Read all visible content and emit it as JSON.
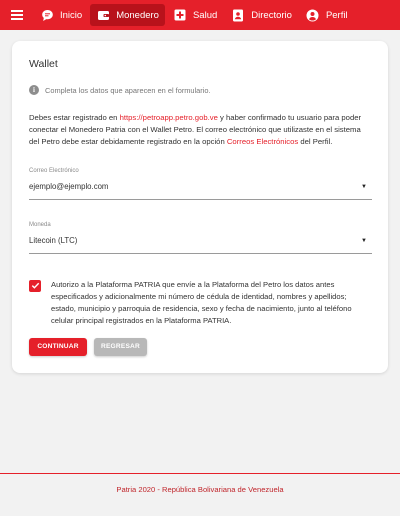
{
  "colors": {
    "brand_red": "#e5202a",
    "active_nav": "#b8121b",
    "secondary_button": "#b8b8b8"
  },
  "topbar": {
    "menu_icon": "hamburger-icon",
    "nav": [
      {
        "label": "Inicio",
        "icon": "chat-bubble-icon",
        "active": false
      },
      {
        "label": "Monedero",
        "icon": "wallet-icon",
        "active": true
      },
      {
        "label": "Salud",
        "icon": "medical-cross-icon",
        "active": false
      },
      {
        "label": "Directorio",
        "icon": "contact-card-icon",
        "active": false
      },
      {
        "label": "Perfil",
        "icon": "user-circle-icon",
        "active": false
      }
    ]
  },
  "card": {
    "title": "Wallet",
    "hint": "Completa los datos que aparecen en el formulario.",
    "intro": {
      "text1": "Debes estar registrado en ",
      "link1": "https://petroapp.petro.gob.ve",
      "text2": " y haber confirmado tu usuario para poder conectar el Monedero Patria con el Wallet Petro. El correo electrónico que utilizaste en el sistema del Petro debe estar debidamente registrado en la opción ",
      "link2": "Correos Electrónicos",
      "text3": " del Perfil."
    },
    "email_field": {
      "label": "Correo Electrónico",
      "value": "ejemplo@ejemplo.com"
    },
    "currency_field": {
      "label": "Moneda",
      "value": "Litecoin (LTC)"
    },
    "consent": {
      "checked": true,
      "text": "Autorizo a la Plataforma PATRIA que envíe a la Plataforma del Petro los datos antes especificados y adicionalmente mi número de cédula de identidad, nombres y apellidos; estado, municipio y parroquia de residencia, sexo y fecha de nacimiento, junto al teléfono celular principal registrados en la Plataforma PATRIA."
    },
    "buttons": {
      "continue": "CONTINUAR",
      "back": "REGRESAR"
    }
  },
  "footer": {
    "text": "Patria 2020 - República Bolivariana de Venezuela"
  }
}
